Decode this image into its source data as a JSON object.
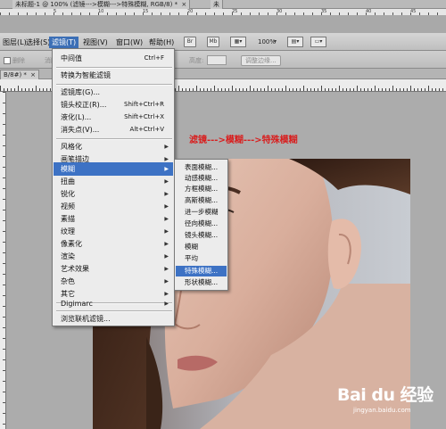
{
  "tabs": {
    "tab1": "未标题-1 @ 100% (滤镜--->模糊--->特殊模糊, RGB/8) *",
    "tab1_close": "×",
    "tab2": "未"
  },
  "menubar": {
    "items": [
      "图层(L)",
      "选择(S)",
      "滤镜(T)",
      "视图(V)",
      "窗口(W)",
      "帮助(H)"
    ],
    "btn_br": "Br",
    "btn_mb": "Mb",
    "zoom": "100%"
  },
  "options": {
    "delete_label": "删除",
    "antialias_label": "消除锯齿",
    "height_label": "高度:",
    "refine_edge": "调整边缘..."
  },
  "doc_tab2": {
    "label": "B/8#) *",
    "close": "×"
  },
  "filter_menu": {
    "items": [
      {
        "label": "中间值",
        "shortcut": "Ctrl+F"
      },
      {
        "label": "转换为智能滤镜",
        "shortcut": ""
      },
      {
        "label": "滤镜库(G)...",
        "shortcut": ""
      },
      {
        "label": "镜头校正(R)...",
        "shortcut": "Shift+Ctrl+R"
      },
      {
        "label": "液化(L)...",
        "shortcut": "Shift+Ctrl+X"
      },
      {
        "label": "消失点(V)...",
        "shortcut": "Alt+Ctrl+V"
      },
      {
        "label": "风格化",
        "submenu": true
      },
      {
        "label": "画笔描边",
        "submenu": true
      },
      {
        "label": "模糊",
        "submenu": true,
        "active": true
      },
      {
        "label": "扭曲",
        "submenu": true
      },
      {
        "label": "锐化",
        "submenu": true
      },
      {
        "label": "视频",
        "submenu": true
      },
      {
        "label": "素描",
        "submenu": true
      },
      {
        "label": "纹理",
        "submenu": true
      },
      {
        "label": "像素化",
        "submenu": true
      },
      {
        "label": "渲染",
        "submenu": true
      },
      {
        "label": "艺术效果",
        "submenu": true
      },
      {
        "label": "杂色",
        "submenu": true
      },
      {
        "label": "其它",
        "submenu": true
      },
      {
        "label": "Digimarc",
        "submenu": true
      },
      {
        "label": "浏览联机滤镜...",
        "shortcut": ""
      }
    ]
  },
  "blur_submenu": {
    "items": [
      "表面模糊...",
      "动感模糊...",
      "方框模糊...",
      "高斯模糊...",
      "进一步模糊",
      "径向模糊...",
      "镜头模糊...",
      "模糊",
      "平均",
      "特殊模糊...",
      "形状模糊..."
    ],
    "active_index": 9
  },
  "annotation": "滤镜--->模糊--->特殊模糊",
  "ruler_numbers": [
    "5",
    "10",
    "15",
    "20",
    "25",
    "30",
    "35",
    "40",
    "45",
    "50"
  ],
  "watermark": {
    "logo": "Bai du 经验",
    "url": "jingyan.baidu.com"
  },
  "colors": {
    "accent": "#3d72c4",
    "annotation": "#d81f1f"
  }
}
